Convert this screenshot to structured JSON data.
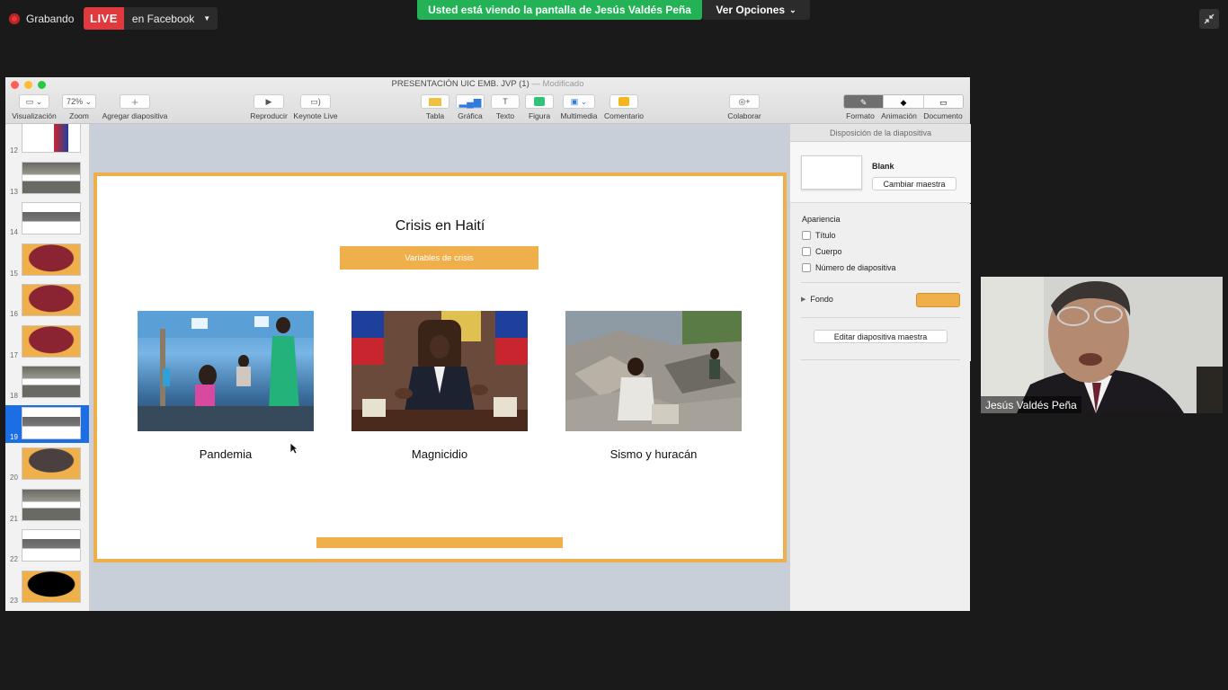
{
  "zoom_overlay": {
    "recording_label": "Grabando",
    "live_label": "LIVE",
    "live_destination": "en Facebook",
    "share_banner": "Usted está viendo la pantalla de Jesús Valdés Peña",
    "view_options": "Ver Opciones"
  },
  "window": {
    "title": "PRESENTACIÓN UIC EMB. JVP (1)",
    "title_status": "— Modificado"
  },
  "toolbar": {
    "visualizacion": "Visualización",
    "zoom_value": "72%",
    "zoom": "Zoom",
    "agregar": "Agregar diapositiva",
    "reproducir": "Reproducir",
    "keynote_live": "Keynote Live",
    "tabla": "Tabla",
    "grafica": "Gráfica",
    "texto": "Texto",
    "texto_glyph": "T",
    "figura": "Figura",
    "multimedia": "Multimedia",
    "comentario": "Comentario",
    "colaborar": "Colaborar",
    "formato": "Formato",
    "animacion": "Animación",
    "documento": "Documento"
  },
  "navigator": {
    "slides": [
      {
        "num": "12",
        "style": "flag"
      },
      {
        "num": "13",
        "style": "photo"
      },
      {
        "num": "14",
        "style": "white"
      },
      {
        "num": "15",
        "style": "orange-maroon"
      },
      {
        "num": "16",
        "style": "orange-maroon"
      },
      {
        "num": "17",
        "style": "orange-maroon"
      },
      {
        "num": "18",
        "style": "photo"
      },
      {
        "num": "19",
        "style": "white",
        "selected": true
      },
      {
        "num": "20",
        "style": "orange"
      },
      {
        "num": "21",
        "style": "photo"
      },
      {
        "num": "22",
        "style": "white"
      },
      {
        "num": "23",
        "style": "orange-black"
      }
    ]
  },
  "slide": {
    "title": "Crisis en Haití",
    "chip": "Variables de crisis",
    "captions": [
      "Pandemia",
      "Magnicidio",
      "Sismo y huracán"
    ],
    "accent": "#efb04c"
  },
  "inspector": {
    "header": "Disposición de la diapositiva",
    "master_name": "Blank",
    "change_master": "Cambiar maestra",
    "appearance": "Apariencia",
    "options": [
      "Título",
      "Cuerpo",
      "Número de diapositiva"
    ],
    "background_label": "Fondo",
    "background_color": "#efb04c",
    "edit_master": "Editar diapositiva maestra"
  },
  "participant": {
    "name": "Jesús Valdés Peña"
  }
}
